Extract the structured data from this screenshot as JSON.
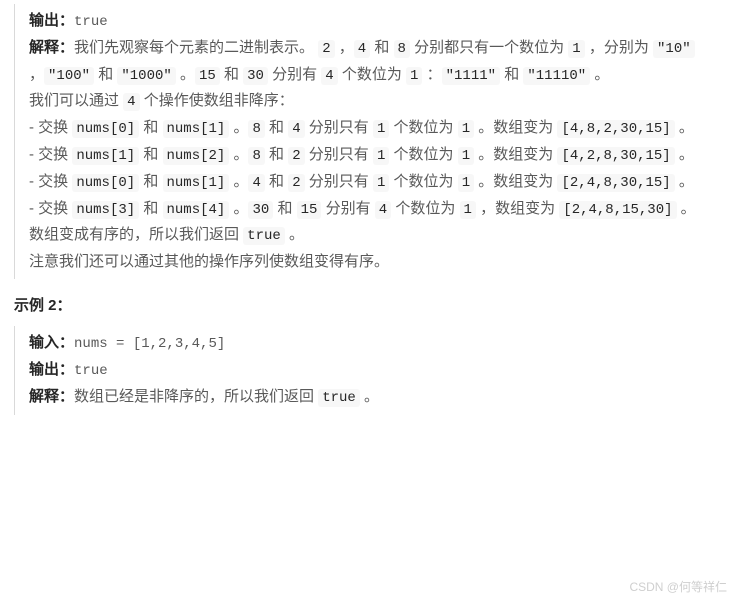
{
  "block1": {
    "output_label": "输出：",
    "output_value": "true",
    "explain_label": "解释：",
    "explain_p1_a": "我们先观察每个元素的二进制表示。 ",
    "explain_p1_b": " ，",
    "explain_p1_c": " 和 ",
    "explain_p1_d": " 分别都只有一个数位为 ",
    "explain_p1_e": " ，分别为 ",
    "explain_p1_f": " ，",
    "explain_p1_g": " 和 ",
    "explain_p1_h": " 。",
    "explain_p1_i": " 和 ",
    "explain_p1_j": " 分别有 ",
    "explain_p1_k": " 个数位为 ",
    "explain_p1_l": " ：",
    "explain_p1_m": " 和 ",
    "explain_p1_n": " 。",
    "c2": "2",
    "c4": "4",
    "c8": "8",
    "c1": "1",
    "c_10": "\"10\"",
    "c_100": "\"100\"",
    "c_1000": "\"1000\"",
    "c15": "15",
    "c30": "30",
    "c4b": "4",
    "c1b": "1",
    "c_1111": "\"1111\"",
    "c_11110": "\"11110\"",
    "explain_p2_a": "我们可以通过 ",
    "explain_p2_b": " 个操作使数组非降序：",
    "c4c": "4",
    "swap1_a": "- 交换 ",
    "swap_and": " 和 ",
    "swap1_b": " 。",
    "swap1_c": " 和 ",
    "swap1_d": " 分别只有 ",
    "swap1_e": " 个数位为 ",
    "swap1_f": " 。数组变为 ",
    "swap1_g": " 。",
    "nums0": "nums[0]",
    "nums1": "nums[1]",
    "nums2": "nums[2]",
    "nums3": "nums[3]",
    "nums4": "nums[4]",
    "s1_v1": "8",
    "s1_v2": "4",
    "s1_arr": "[4,8,2,30,15]",
    "s2_v1": "8",
    "s2_v2": "2",
    "s2_arr": "[4,2,8,30,15]",
    "s3_v1": "4",
    "s3_v2": "2",
    "s3_arr": "[2,4,8,30,15]",
    "swap4_d": " 分别有 ",
    "swap4_e2": " ，数组变为 ",
    "s4_v1": "30",
    "s4_v2": "15",
    "s4_cnt": "4",
    "s4_arr": "[2,4,8,15,30]",
    "explain_p3_a": "数组变成有序的，所以我们返回 ",
    "explain_p3_b": " 。",
    "ctrue": "true",
    "explain_p4": "注意我们还可以通过其他的操作序列使数组变得有序。"
  },
  "heading2": "示例 2：",
  "block2": {
    "input_label": "输入：",
    "input_value": "nums = [1,2,3,4,5]",
    "output_label": "输出：",
    "output_value": "true",
    "explain_label": "解释：",
    "explain_a": "数组已经是非降序的，所以我们返回 ",
    "explain_b": " 。",
    "ctrue": "true"
  },
  "watermark": "CSDN @何等祥仁"
}
